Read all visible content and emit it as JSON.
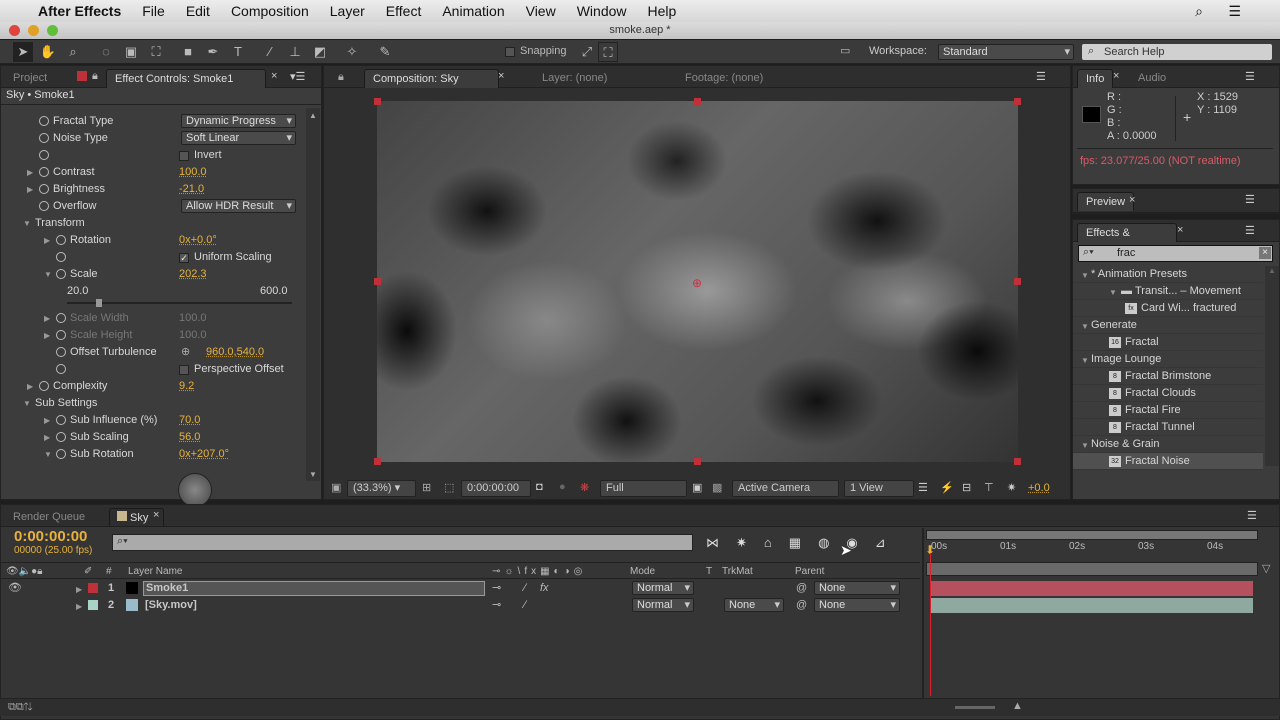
{
  "menubar": {
    "app": "After Effects",
    "items": [
      "File",
      "Edit",
      "Composition",
      "Layer",
      "Effect",
      "Animation",
      "View",
      "Window",
      "Help"
    ]
  },
  "window_title": "smoke.aep *",
  "toolbar": {
    "snapping": "Snapping",
    "workspace_label": "Workspace:",
    "workspace": "Standard",
    "search_help": "Search Help"
  },
  "left_panel": {
    "tab_project": "Project",
    "tab_effect": "Effect Controls: Smoke1",
    "breadcrumb": "Sky • Smoke1",
    "rows": [
      {
        "label": "Fractal Type",
        "indent": 1,
        "dropdown": "Dynamic Progress"
      },
      {
        "label": "Noise Type",
        "indent": 1,
        "dropdown": "Soft Linear"
      },
      {
        "label": "",
        "indent": 1,
        "checkbox": "Invert",
        "checked": false
      },
      {
        "label": "Contrast",
        "indent": 1,
        "twirl": true,
        "value": "100.0"
      },
      {
        "label": "Brightness",
        "indent": 1,
        "twirl": true,
        "value": "-21.0"
      },
      {
        "label": "Overflow",
        "indent": 1,
        "dropdown": "Allow HDR Result"
      },
      {
        "label": "Transform",
        "indent": 0,
        "group": true,
        "open": true
      },
      {
        "label": "Rotation",
        "indent": 2,
        "twirl": true,
        "value": "0x+0.0°"
      },
      {
        "label": "",
        "indent": 2,
        "checkbox": "Uniform Scaling",
        "checked": true
      },
      {
        "label": "Scale",
        "indent": 2,
        "twirl": true,
        "open": true,
        "value": "202.3"
      },
      {
        "slider": true,
        "min": "20.0",
        "max": "600.0",
        "fraction": 0.13
      },
      {
        "label": "Scale Width",
        "indent": 2,
        "twirl": true,
        "value": "100.0",
        "disabled": true
      },
      {
        "label": "Scale Height",
        "indent": 2,
        "twirl": true,
        "value": "100.0",
        "disabled": true
      },
      {
        "label": "Offset Turbulence",
        "indent": 2,
        "value": "960.0,540.0",
        "target": true
      },
      {
        "label": "",
        "indent": 2,
        "checkbox": "Perspective Offset",
        "checked": false
      },
      {
        "label": "Complexity",
        "indent": 1,
        "twirl": true,
        "value": "9.2"
      },
      {
        "label": "Sub Settings",
        "indent": 0,
        "group": true,
        "open": true
      },
      {
        "label": "Sub Influence (%)",
        "indent": 2,
        "twirl": true,
        "value": "70.0"
      },
      {
        "label": "Sub Scaling",
        "indent": 2,
        "twirl": true,
        "value": "56.0"
      },
      {
        "label": "Sub Rotation",
        "indent": 2,
        "twirl": true,
        "open": true,
        "value": "0x+207.0°"
      }
    ]
  },
  "comp": {
    "tab": "Composition: Sky",
    "layer": "Layer: (none)",
    "footage": "Footage: (none)",
    "zoom": "(33.3%)",
    "timecode": "0:00:00:00",
    "resolution": "Full",
    "camera": "Active Camera",
    "views": "1 View",
    "exposure": "+0.0"
  },
  "info": {
    "tab": "Info",
    "tab2": "Audio",
    "r": "R :",
    "g": "G :",
    "b": "B :",
    "a": "A : 0.0000",
    "x": "X : 1529",
    "y": "Y : 1109",
    "fps": "fps: 23.077/25.00 (NOT realtime)"
  },
  "preview": {
    "tab": "Preview"
  },
  "effects": {
    "tab": "Effects & Presets",
    "search": "frac",
    "tree": [
      {
        "label": "* Animation Presets",
        "level": 0
      },
      {
        "label": "Transit... – Movement",
        "level": 1,
        "folder": true
      },
      {
        "label": "Card Wi... fractured",
        "level": 2,
        "badge": "fx"
      },
      {
        "label": "Generate",
        "level": 0
      },
      {
        "label": "Fractal",
        "level": 1,
        "badge": "16"
      },
      {
        "label": "Image Lounge",
        "level": 0
      },
      {
        "label": "Fractal Brimstone",
        "level": 1,
        "badge": "8"
      },
      {
        "label": "Fractal Clouds",
        "level": 1,
        "badge": "8"
      },
      {
        "label": "Fractal Fire",
        "level": 1,
        "badge": "8"
      },
      {
        "label": "Fractal Tunnel",
        "level": 1,
        "badge": "8"
      },
      {
        "label": "Noise & Grain",
        "level": 0
      },
      {
        "label": "Fractal Noise",
        "level": 1,
        "badge": "32",
        "selected": true
      }
    ]
  },
  "timeline": {
    "tab_render": "Render Queue",
    "tab_comp": "Sky",
    "timecode": "0:00:00:00",
    "frames": "00000 (25.00 fps)",
    "headers": {
      "num": "#",
      "layer_name": "Layer Name",
      "mode": "Mode",
      "t": "T",
      "trkmat": "TrkMat",
      "parent": "Parent"
    },
    "ruler": [
      "00s",
      "01s",
      "02s",
      "03s",
      "04s"
    ],
    "layers": [
      {
        "num": "1",
        "name": "Smoke1",
        "color": "#c0303a",
        "mode": "Normal",
        "trkmat": "",
        "parent": "None",
        "bar": "#b5505e"
      },
      {
        "num": "2",
        "name": "[Sky.mov]",
        "color": "#a8d4c8",
        "mode": "Normal",
        "trkmat": "None",
        "parent": "None",
        "bar": "#8fa8a0"
      }
    ]
  }
}
